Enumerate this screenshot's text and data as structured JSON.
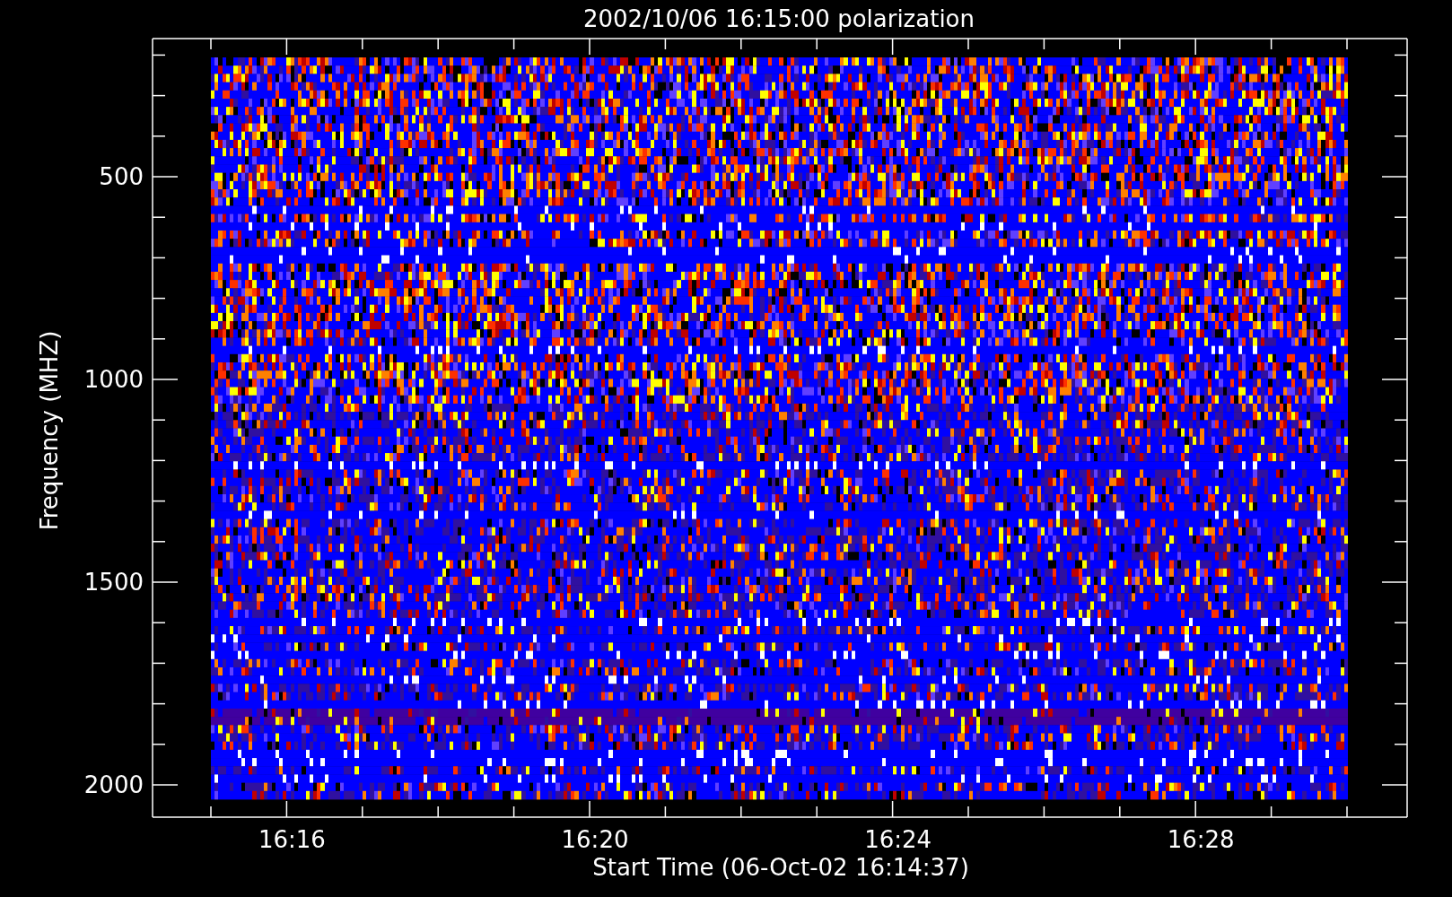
{
  "title": "2002/10/06 16:15:00 polarization",
  "y_axis": {
    "label": "Frequency (MHZ)",
    "ticks": [
      "500",
      "1000",
      "1500",
      "2000"
    ]
  },
  "x_axis": {
    "label": "Start Time (06-Oct-02 16:14:37)",
    "ticks": [
      "16:16",
      "16:20",
      "16:24",
      "16:28"
    ]
  }
}
